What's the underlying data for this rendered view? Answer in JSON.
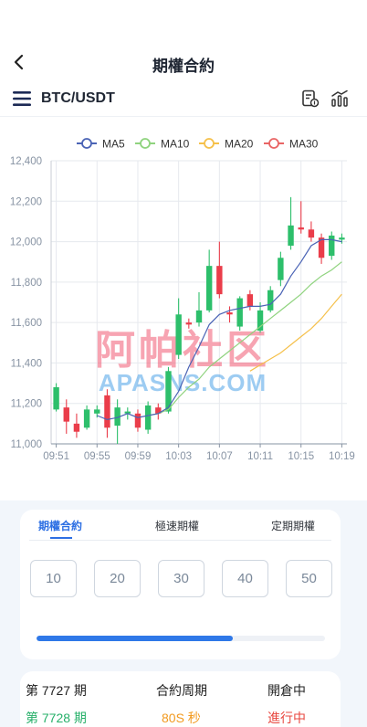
{
  "header": {
    "title": "期權合約",
    "back_icon": "chevron-left-icon"
  },
  "pair_bar": {
    "symbol": "BTC/USDT",
    "menu_icon": "hamburger-icon",
    "calc_icon": "calculator-icon",
    "stats_icon": "bar-chart-icon"
  },
  "watermark": {
    "line1": "阿帕社区",
    "line2": "APASNS.COM"
  },
  "chart_data": {
    "type": "candlestick",
    "legend": [
      {
        "name": "MA5",
        "color": "#4a63b5"
      },
      {
        "name": "MA10",
        "color": "#8fd37e"
      },
      {
        "name": "MA20",
        "color": "#f5c04a"
      },
      {
        "name": "MA30",
        "color": "#e96565"
      }
    ],
    "y_ticks": [
      "12,400",
      "12,200",
      "12,000",
      "11,800",
      "11,600",
      "11,400",
      "11,200",
      "11,000"
    ],
    "ylim": [
      11000,
      12400
    ],
    "x_ticks": [
      "09:51",
      "09:55",
      "09:59",
      "10:03",
      "10:07",
      "10:11",
      "10:15",
      "10:19"
    ],
    "candles": [
      {
        "o": 11170,
        "c": 11280,
        "h": 11300,
        "l": 11160
      },
      {
        "o": 11180,
        "c": 11110,
        "h": 11220,
        "l": 11050
      },
      {
        "o": 11100,
        "c": 11060,
        "h": 11150,
        "l": 11030
      },
      {
        "o": 11080,
        "c": 11170,
        "h": 11190,
        "l": 11070
      },
      {
        "o": 11150,
        "c": 11170,
        "h": 11190,
        "l": 11130
      },
      {
        "o": 11240,
        "c": 11080,
        "h": 11270,
        "l": 11030
      },
      {
        "o": 11090,
        "c": 11180,
        "h": 11220,
        "l": 11000
      },
      {
        "o": 11150,
        "c": 11160,
        "h": 11180,
        "l": 11120
      },
      {
        "o": 11150,
        "c": 11080,
        "h": 11170,
        "l": 11060
      },
      {
        "o": 11070,
        "c": 11190,
        "h": 11210,
        "l": 11050
      },
      {
        "o": 11180,
        "c": 11150,
        "h": 11200,
        "l": 11120
      },
      {
        "o": 11160,
        "c": 11360,
        "h": 11380,
        "l": 11150
      },
      {
        "o": 11440,
        "c": 11640,
        "h": 11720,
        "l": 11420
      },
      {
        "o": 11600,
        "c": 11590,
        "h": 11620,
        "l": 11570
      },
      {
        "o": 11600,
        "c": 11660,
        "h": 11750,
        "l": 11580
      },
      {
        "o": 11660,
        "c": 11880,
        "h": 11960,
        "l": 11650
      },
      {
        "o": 11880,
        "c": 11740,
        "h": 12000,
        "l": 11720
      },
      {
        "o": 11650,
        "c": 11640,
        "h": 11680,
        "l": 11600
      },
      {
        "o": 11580,
        "c": 11720,
        "h": 11730,
        "l": 11560
      },
      {
        "o": 11740,
        "c": 11680,
        "h": 11760,
        "l": 11660
      },
      {
        "o": 11560,
        "c": 11660,
        "h": 11700,
        "l": 11550
      },
      {
        "o": 11660,
        "c": 11760,
        "h": 11780,
        "l": 11650
      },
      {
        "o": 11810,
        "c": 11920,
        "h": 11950,
        "l": 11780
      },
      {
        "o": 11980,
        "c": 12080,
        "h": 12220,
        "l": 11960
      },
      {
        "o": 12070,
        "c": 12060,
        "h": 12200,
        "l": 12040
      },
      {
        "o": 12060,
        "c": 12020,
        "h": 12100,
        "l": 12000
      },
      {
        "o": 12020,
        "c": 11920,
        "h": 12040,
        "l": 11890
      },
      {
        "o": 11930,
        "c": 12030,
        "h": 12050,
        "l": 11910
      },
      {
        "o": 12010,
        "c": 12020,
        "h": 12040,
        "l": 11990
      }
    ],
    "ma5": [
      null,
      null,
      null,
      null,
      11140,
      11120,
      11130,
      11150,
      11130,
      11140,
      11150,
      11180,
      11260,
      11380,
      11480,
      11590,
      11640,
      11660,
      11670,
      11680,
      11680,
      11690,
      11740,
      11830,
      11900,
      11980,
      12010,
      12010,
      12000
    ],
    "ma10": [
      null,
      null,
      null,
      null,
      null,
      null,
      null,
      null,
      null,
      11140,
      11150,
      11170,
      11230,
      11280,
      11320,
      11380,
      11420,
      11460,
      11500,
      11540,
      11580,
      11620,
      11660,
      11700,
      11740,
      11790,
      11830,
      11860,
      11900
    ],
    "ma20": [
      null,
      null,
      null,
      null,
      null,
      null,
      null,
      null,
      null,
      null,
      null,
      null,
      null,
      null,
      null,
      null,
      null,
      null,
      null,
      11360,
      11390,
      11420,
      11450,
      11490,
      11530,
      11570,
      11620,
      11680,
      11740
    ]
  },
  "contract_panel": {
    "tabs": [
      "期權合約",
      "極速期權",
      "定期期權"
    ],
    "active_tab": 0,
    "durations": [
      "10",
      "20",
      "30",
      "40",
      "50"
    ],
    "progress": 0.68
  },
  "period_info": {
    "current_period": "第 7727 期",
    "cycle_label": "合約周期",
    "open_status": "開倉中",
    "next_period": "第 7728 期",
    "cycle_value": "80S 秒",
    "running_status": "進行中"
  }
}
